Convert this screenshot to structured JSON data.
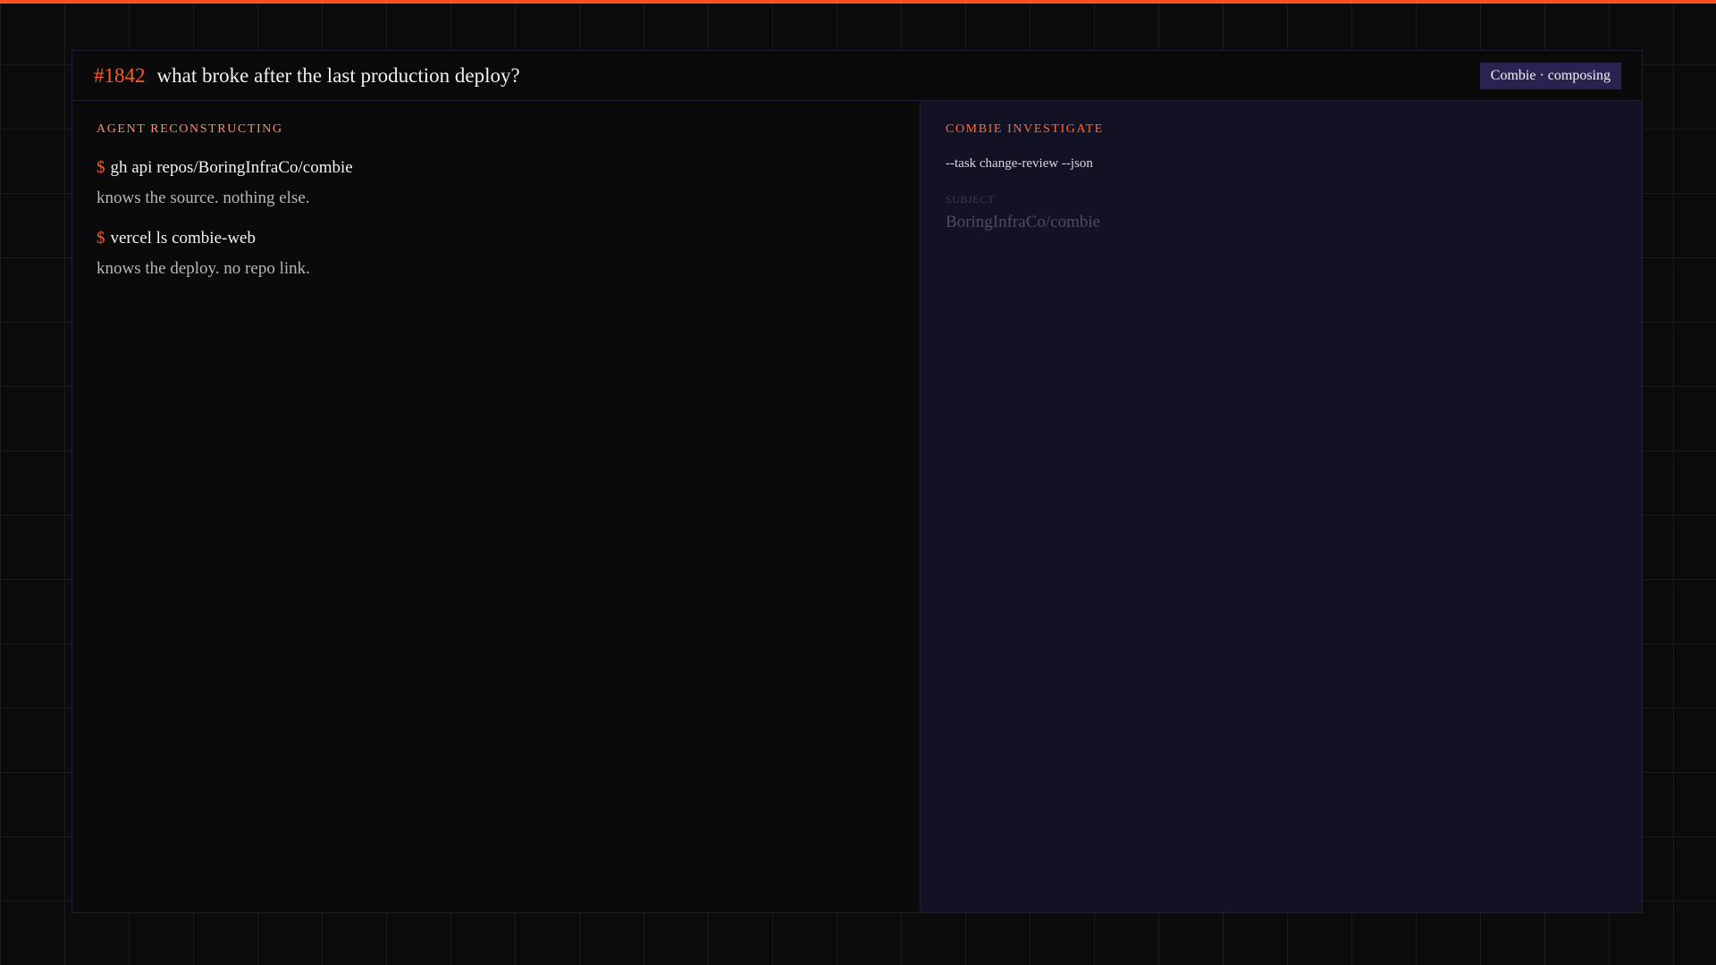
{
  "header": {
    "ticket_id": "#1842",
    "title": "what broke after the last production deploy?",
    "status": "Combie · composing"
  },
  "agent": {
    "label": "AGENT RECONSTRUCTING",
    "prompt_symbol": "$",
    "commands": [
      {
        "command": "gh api repos/BoringInfraCo/combie",
        "note": "knows the source. nothing else."
      },
      {
        "command": "vercel ls combie-web",
        "note": "knows the deploy. no repo link."
      }
    ]
  },
  "combie": {
    "label": "COMBIE INVESTIGATE",
    "flags": "--task change-review --json",
    "subject_label": "SUBJECT",
    "subject_value": "BoringInfraCo/combie"
  },
  "colors": {
    "accent": "#ff5a2a",
    "right_pane_bg": "#131225",
    "badge_bg": "#2a2350"
  }
}
